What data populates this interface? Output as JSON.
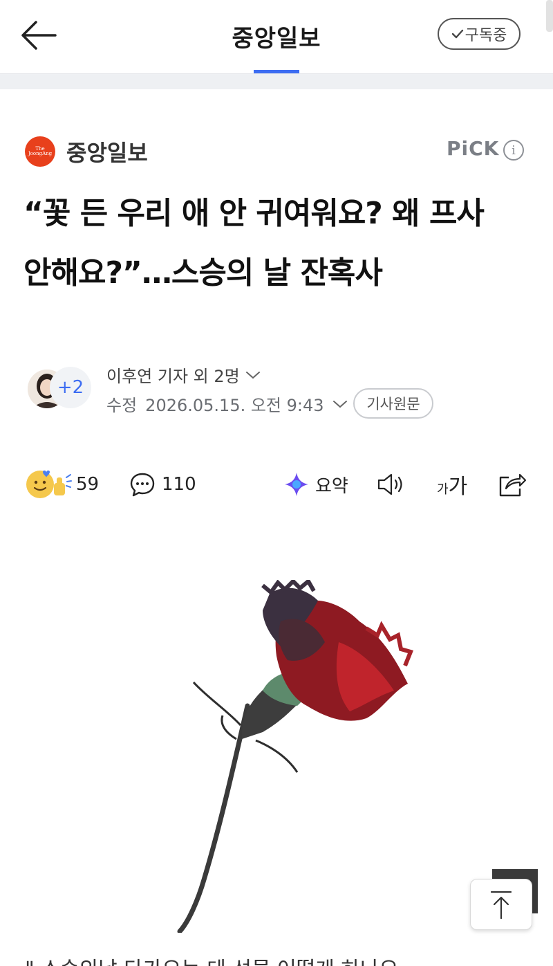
{
  "header": {
    "title": "중앙일보",
    "subscribe_label": "구독중"
  },
  "press": {
    "logo_lines": [
      "The",
      "JoongAng"
    ],
    "name": "중앙일보",
    "pick_label": "PiCK",
    "info_icon": "info-icon"
  },
  "article": {
    "headline": "“꽃 든 우리 애 안 귀여워요? 왜 프사 안해요?”…스승의 날 잔혹사",
    "author_extra": "+2",
    "byline": "이후연 기자 외 2명",
    "date_label": "수정",
    "date_value": "2026.05.15. 오전 9:43",
    "original_button": "기사원문",
    "body_preview": "\" 스승의날 다가오는 데 선물 어떻게 하나요"
  },
  "actions": {
    "reaction_count": "59",
    "comment_count": "110",
    "summary_label": "요약",
    "font_small": "가",
    "font_large": "가"
  },
  "colors": {
    "accent": "#3d6df2",
    "brand": "#e8401c"
  }
}
